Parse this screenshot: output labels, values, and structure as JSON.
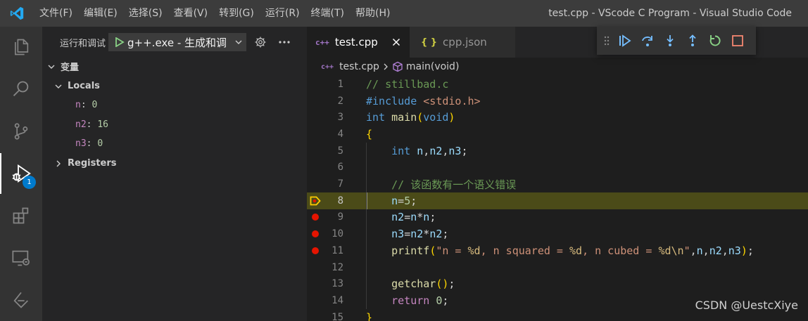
{
  "titlebar": {
    "menus": [
      "文件(F)",
      "编辑(E)",
      "选择(S)",
      "查看(V)",
      "转到(G)",
      "运行(R)",
      "终端(T)",
      "帮助(H)"
    ],
    "window_title": "test.cpp - VScode C Program - Visual Studio Code"
  },
  "activity_bar": {
    "items": [
      "explorer-icon",
      "search-icon",
      "source-control-icon",
      "run-debug-icon",
      "extensions-icon",
      "remote-explorer-icon",
      "testing-icon"
    ],
    "debug_badge": "1"
  },
  "sidebar": {
    "run_label": "运行和调试",
    "config_name": "g++.exe - 生成和调",
    "variables_section": "变量",
    "locals_label": "Locals",
    "locals": [
      {
        "name": "n",
        "value": "0"
      },
      {
        "name": "n2",
        "value": "16"
      },
      {
        "name": "n3",
        "value": "0"
      }
    ],
    "registers_label": "Registers"
  },
  "tabs": [
    {
      "label": "test.cpp",
      "icon": "c++",
      "active": true
    },
    {
      "label": "cpp.json",
      "icon": "{ }",
      "active": false
    }
  ],
  "breadcrumb": {
    "file": "test.cpp",
    "symbol": "main(void)"
  },
  "code": {
    "current_line": 8,
    "breakpoints": [
      9,
      10,
      11
    ],
    "lines": [
      {
        "n": "1",
        "text": "// stillbad.c"
      },
      {
        "n": "2",
        "text": "#include <stdio.h>"
      },
      {
        "n": "3",
        "text": "int main(void)"
      },
      {
        "n": "4",
        "text": "{"
      },
      {
        "n": "5",
        "text": "    int n,n2,n3;"
      },
      {
        "n": "6",
        "text": ""
      },
      {
        "n": "7",
        "text": "    // 该函数有一个语义错误"
      },
      {
        "n": "8",
        "text": "    n=5;"
      },
      {
        "n": "9",
        "text": "    n2=n*n;"
      },
      {
        "n": "10",
        "text": "    n3=n2*n2;"
      },
      {
        "n": "11",
        "text": "    printf(\"n = %d, n squared = %d, n cubed = %d\\n\",n,n2,n3);"
      },
      {
        "n": "12",
        "text": ""
      },
      {
        "n": "13",
        "text": "    getchar();"
      },
      {
        "n": "14",
        "text": "    return 0;"
      },
      {
        "n": "15",
        "text": "}"
      }
    ]
  },
  "colors": {
    "accent": "#007acc",
    "breakpoint": "#e51400",
    "current_line_bg": "#4b4b18",
    "debug_blue": "#75beff",
    "debug_green": "#89d185",
    "debug_red": "#f48771"
  },
  "watermark": "CSDN @UestcXiye"
}
